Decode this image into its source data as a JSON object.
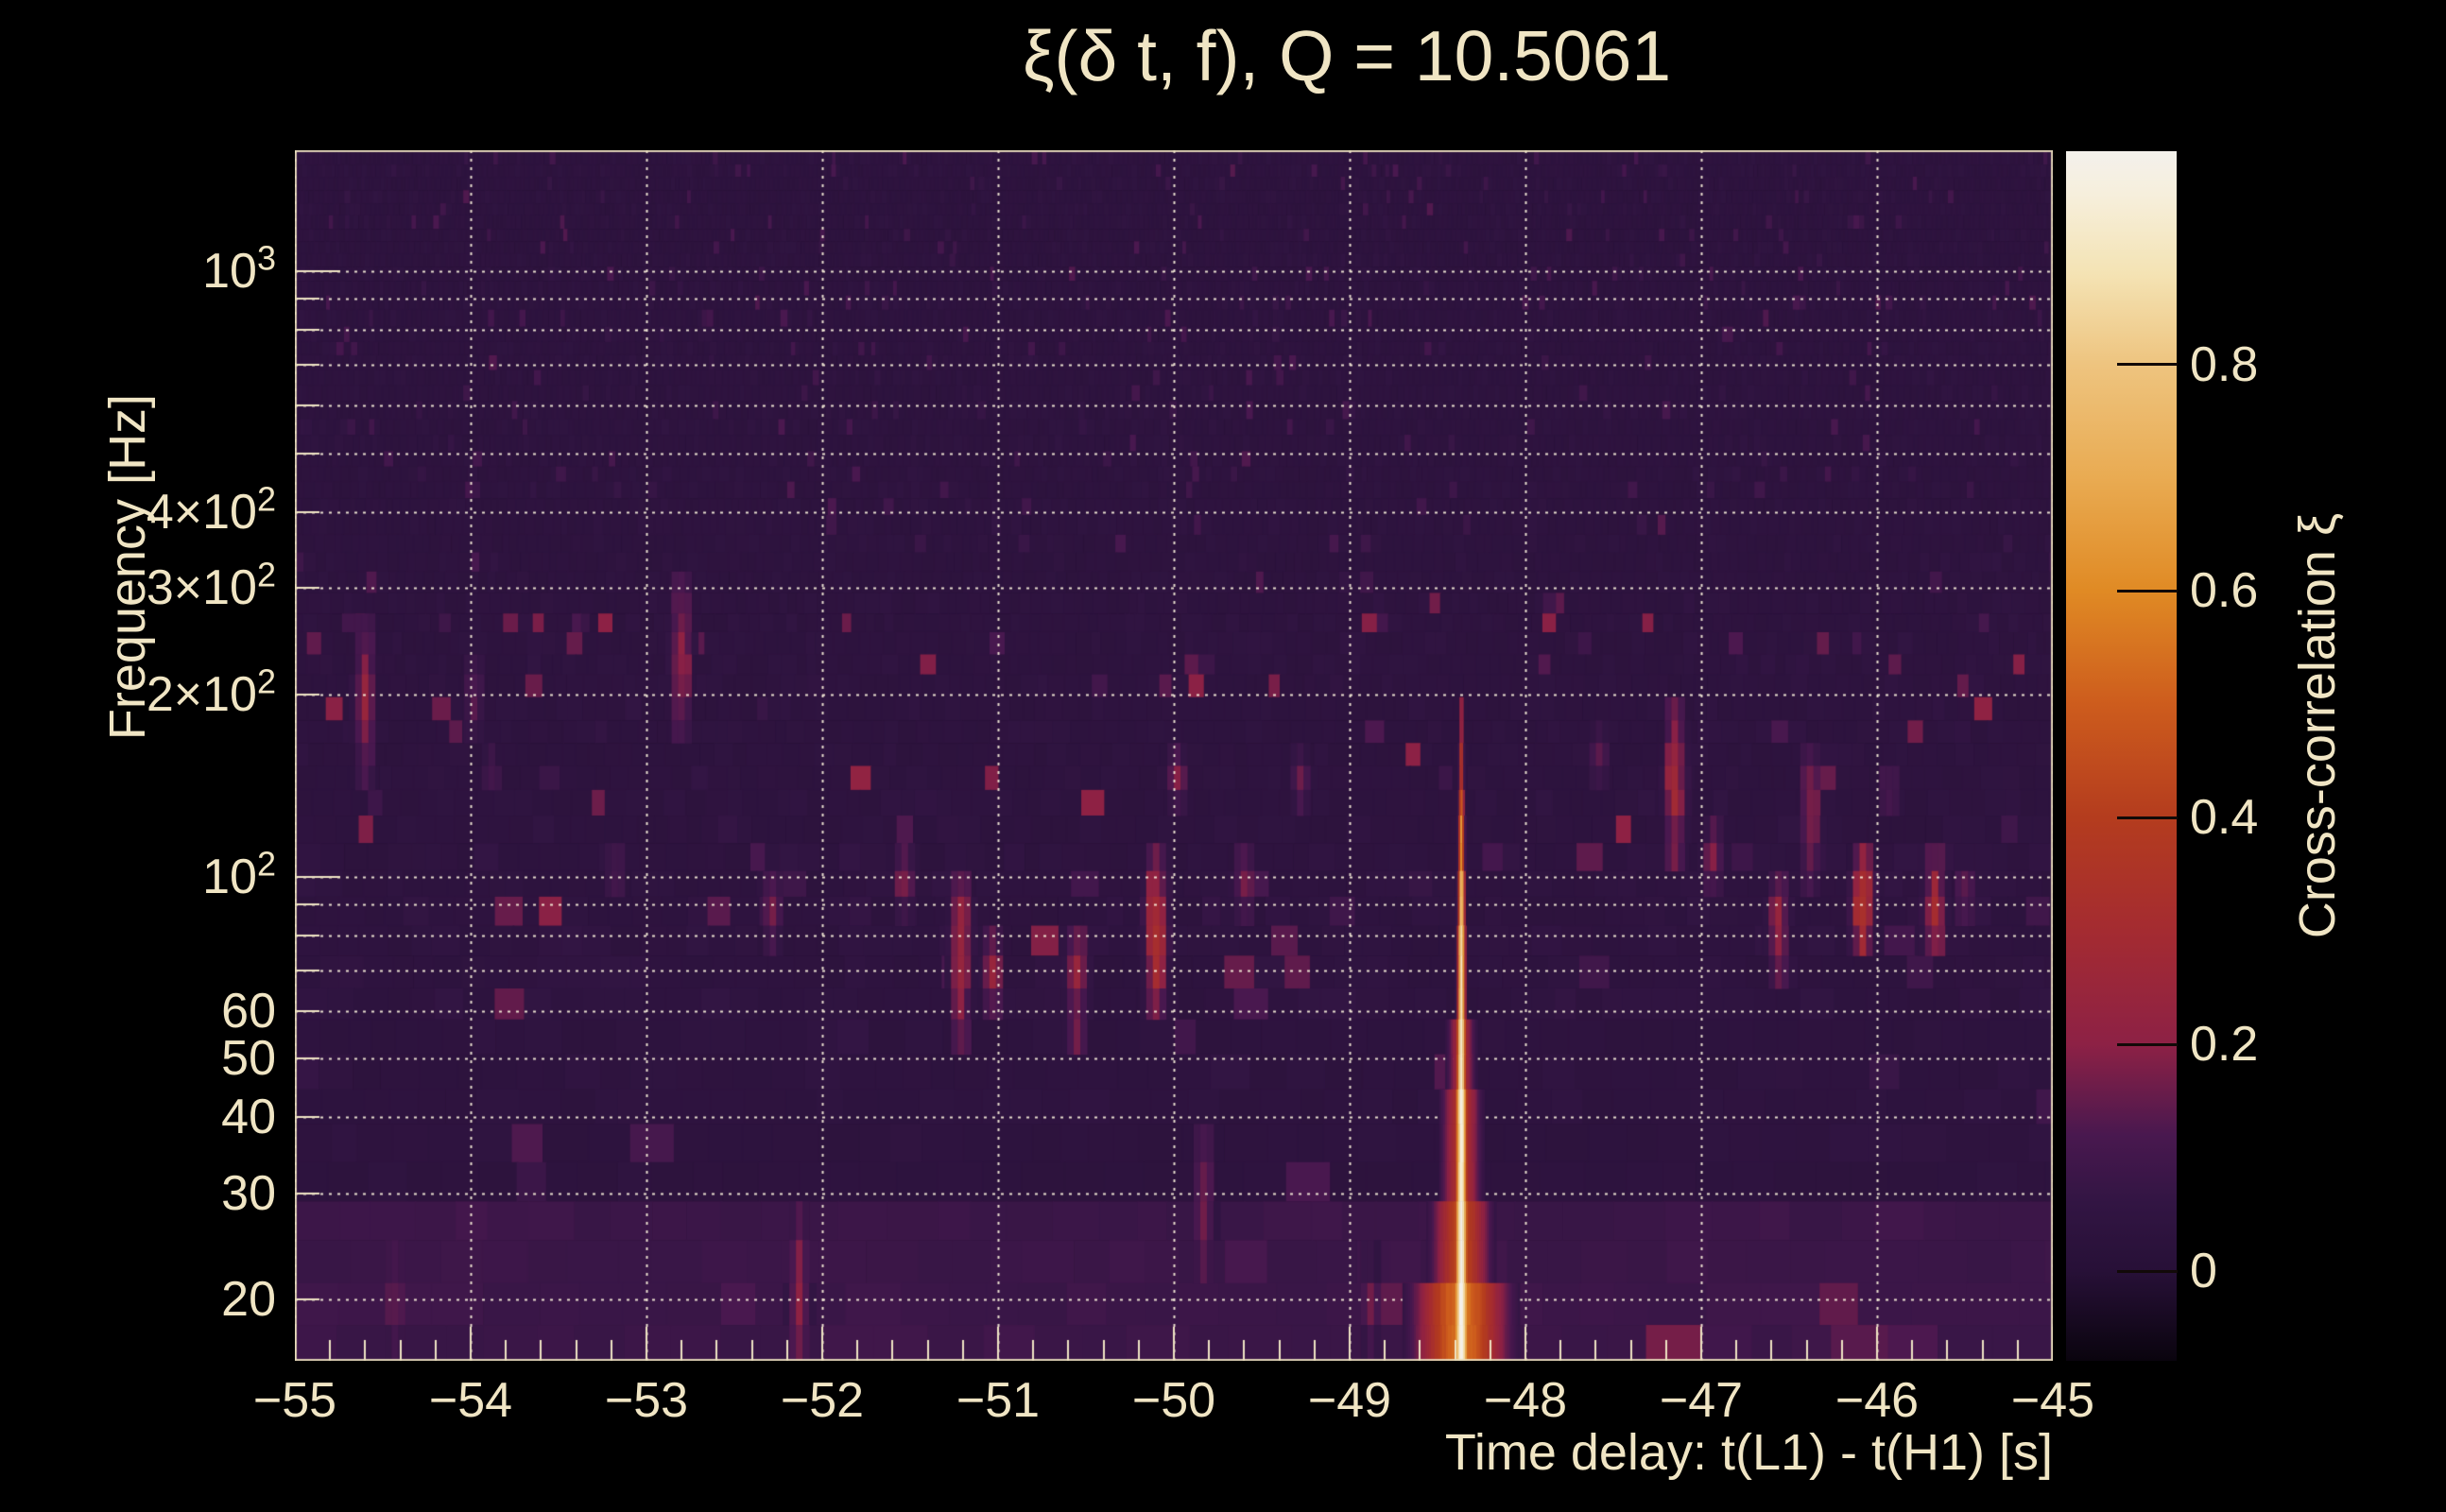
{
  "figure": {
    "title": "ξ(δ t, f), Q = 10.5061",
    "background_color": "#000000",
    "text_color": "#f0e5c4"
  },
  "chart_data": {
    "type": "heatmap",
    "title": "ξ(δ t, f), Q = 10.5061",
    "xlabel": "Time delay: t(L1) - t(H1) [s]",
    "ylabel": "Frequency [Hz]",
    "x_range": [
      -55,
      -45
    ],
    "y_range_hz": [
      15.85,
      1585
    ],
    "y_scale": "log",
    "grid": {
      "style": "dotted",
      "color": "rgba(248,240,218,0.92)",
      "x_lines": [
        -55,
        -54,
        -53,
        -52,
        -51,
        -50,
        -49,
        -48,
        -47,
        -46,
        -45
      ],
      "y_lines_hz": [
        20,
        30,
        40,
        50,
        60,
        70,
        80,
        90,
        100,
        200,
        300,
        400,
        500,
        600,
        700,
        800,
        900,
        1000
      ]
    },
    "x_ticks": [
      {
        "t": -55,
        "label": "−55"
      },
      {
        "t": -54,
        "label": "−54"
      },
      {
        "t": -53,
        "label": "−53"
      },
      {
        "t": -52,
        "label": "−52"
      },
      {
        "t": -51,
        "label": "−51"
      },
      {
        "t": -50,
        "label": "−50"
      },
      {
        "t": -49,
        "label": "−49"
      },
      {
        "t": -48,
        "label": "−48"
      },
      {
        "t": -47,
        "label": "−47"
      },
      {
        "t": -46,
        "label": "−46"
      },
      {
        "t": -45,
        "label": "−45"
      }
    ],
    "x_minor_tick_step": 0.2,
    "y_ticks": [
      {
        "f": 1000,
        "text": "10",
        "sup": "3"
      },
      {
        "f": 400,
        "text": "4×10",
        "sup": "2"
      },
      {
        "f": 300,
        "text": "3×10",
        "sup": "2"
      },
      {
        "f": 200,
        "text": "2×10",
        "sup": "2"
      },
      {
        "f": 100,
        "text": "10",
        "sup": "2"
      },
      {
        "f": 60,
        "text": "60"
      },
      {
        "f": 50,
        "text": "50"
      },
      {
        "f": 40,
        "text": "40"
      },
      {
        "f": 30,
        "text": "30"
      },
      {
        "f": 20,
        "text": "20"
      }
    ],
    "colorbar": {
      "label": "Cross-correlation ξ",
      "value_range": [
        -0.079,
        0.988
      ],
      "ticks": [
        {
          "v": 0.8,
          "label": "0.8"
        },
        {
          "v": 0.6,
          "label": "0.6"
        },
        {
          "v": 0.4,
          "label": "0.4"
        },
        {
          "v": 0.2,
          "label": "0.2"
        },
        {
          "v": 0.0,
          "label": "0"
        }
      ],
      "stops": [
        [
          -0.079,
          "#0a040e"
        ],
        [
          0.0,
          "#271037"
        ],
        [
          0.06,
          "#321543"
        ],
        [
          0.12,
          "#49184f"
        ],
        [
          0.2,
          "#8d2145"
        ],
        [
          0.3,
          "#a42b31"
        ],
        [
          0.4,
          "#b43c1e"
        ],
        [
          0.5,
          "#cd5c1d"
        ],
        [
          0.6,
          "#e08a24"
        ],
        [
          0.7,
          "#e9ab52"
        ],
        [
          0.8,
          "#eec47f"
        ],
        [
          0.88,
          "#f4e3b4"
        ],
        [
          0.95,
          "#f6efdc"
        ],
        [
          0.988,
          "#f4f1ec"
        ]
      ]
    },
    "main_feature": {
      "description": "bright cross-correlation chirp track",
      "t_center": -48.37,
      "segments": [
        {
          "f_lo": 15.85,
          "f_hi": 22,
          "peak": 1.0,
          "sigma_s": 0.03,
          "halo_peak": 0.55,
          "halo_sigma_s": 0.16
        },
        {
          "f_lo": 22,
          "f_hi": 30,
          "peak": 0.98,
          "sigma_s": 0.026,
          "halo_peak": 0.45,
          "halo_sigma_s": 0.1
        },
        {
          "f_lo": 30,
          "f_hi": 42,
          "peak": 0.96,
          "sigma_s": 0.022,
          "halo_peak": 0.35,
          "halo_sigma_s": 0.07
        },
        {
          "f_lo": 42,
          "f_hi": 60,
          "peak": 0.94,
          "sigma_s": 0.018,
          "halo_peak": 0.3,
          "halo_sigma_s": 0.05
        },
        {
          "f_lo": 60,
          "f_hi": 80,
          "peak": 0.88,
          "sigma_s": 0.014,
          "halo_peak": 0.0,
          "halo_sigma_s": 0.05
        },
        {
          "f_lo": 80,
          "f_hi": 100,
          "peak": 0.8,
          "sigma_s": 0.012,
          "halo_peak": 0.0,
          "halo_sigma_s": 0.05
        },
        {
          "f_lo": 100,
          "f_hi": 120,
          "peak": 0.62,
          "sigma_s": 0.011,
          "halo_peak": 0.0,
          "halo_sigma_s": 0.05
        },
        {
          "f_lo": 120,
          "f_hi": 140,
          "peak": 0.5,
          "sigma_s": 0.01,
          "halo_peak": 0.0,
          "halo_sigma_s": 0.05
        },
        {
          "f_lo": 140,
          "f_hi": 165,
          "peak": 0.4,
          "sigma_s": 0.009,
          "halo_peak": 0.0,
          "halo_sigma_s": 0.05
        },
        {
          "f_lo": 165,
          "f_hi": 190,
          "peak": 0.26,
          "sigma_s": 0.009,
          "halo_peak": 0.0,
          "halo_sigma_s": 0.05
        }
      ]
    },
    "secondary_features": [
      {
        "t": -54.62,
        "f_lo": 150,
        "f_hi": 260,
        "peak": 0.22
      },
      {
        "t": -54.45,
        "f_lo": 17,
        "f_hi": 24,
        "peak": 0.18
      },
      {
        "t": -54.0,
        "f_lo": 180,
        "f_hi": 220,
        "peak": 0.15
      },
      {
        "t": -53.9,
        "f_lo": 140,
        "f_hi": 160,
        "peak": 0.14
      },
      {
        "t": -53.2,
        "f_lo": 95,
        "f_hi": 110,
        "peak": 0.16
      },
      {
        "t": -52.82,
        "f_lo": 180,
        "f_hi": 300,
        "peak": 0.24
      },
      {
        "t": -52.3,
        "f_lo": 80,
        "f_hi": 100,
        "peak": 0.18
      },
      {
        "t": -52.15,
        "f_lo": 16,
        "f_hi": 26,
        "peak": 0.22
      },
      {
        "t": -51.55,
        "f_lo": 88,
        "f_hi": 106,
        "peak": 0.2
      },
      {
        "t": -51.23,
        "f_lo": 58,
        "f_hi": 100,
        "peak": 0.28
      },
      {
        "t": -51.05,
        "f_lo": 60,
        "f_hi": 80,
        "peak": 0.22
      },
      {
        "t": -50.57,
        "f_lo": 58,
        "f_hi": 82,
        "peak": 0.26
      },
      {
        "t": -50.12,
        "f_lo": 62,
        "f_hi": 108,
        "peak": 0.35
      },
      {
        "t": -50.0,
        "f_lo": 130,
        "f_hi": 160,
        "peak": 0.18
      },
      {
        "t": -49.85,
        "f_lo": 24,
        "f_hi": 34,
        "peak": 0.22
      },
      {
        "t": -49.62,
        "f_lo": 90,
        "f_hi": 110,
        "peak": 0.2
      },
      {
        "t": -49.3,
        "f_lo": 130,
        "f_hi": 155,
        "peak": 0.16
      },
      {
        "t": -48.9,
        "f_lo": 17,
        "f_hi": 22,
        "peak": 0.16
      },
      {
        "t": -47.6,
        "f_lo": 140,
        "f_hi": 170,
        "peak": 0.14
      },
      {
        "t": -47.17,
        "f_lo": 110,
        "f_hi": 185,
        "peak": 0.28
      },
      {
        "t": -46.95,
        "f_lo": 95,
        "f_hi": 120,
        "peak": 0.2
      },
      {
        "t": -46.58,
        "f_lo": 72,
        "f_hi": 95,
        "peak": 0.26
      },
      {
        "t": -46.4,
        "f_lo": 100,
        "f_hi": 160,
        "peak": 0.22
      },
      {
        "t": -46.1,
        "f_lo": 76,
        "f_hi": 108,
        "peak": 0.38
      },
      {
        "t": -45.95,
        "f_lo": 130,
        "f_hi": 150,
        "peak": 0.16
      },
      {
        "t": -45.69,
        "f_lo": 75,
        "f_hi": 105,
        "peak": 0.3
      },
      {
        "t": -45.52,
        "f_lo": 88,
        "f_hi": 100,
        "peak": 0.22
      }
    ]
  }
}
